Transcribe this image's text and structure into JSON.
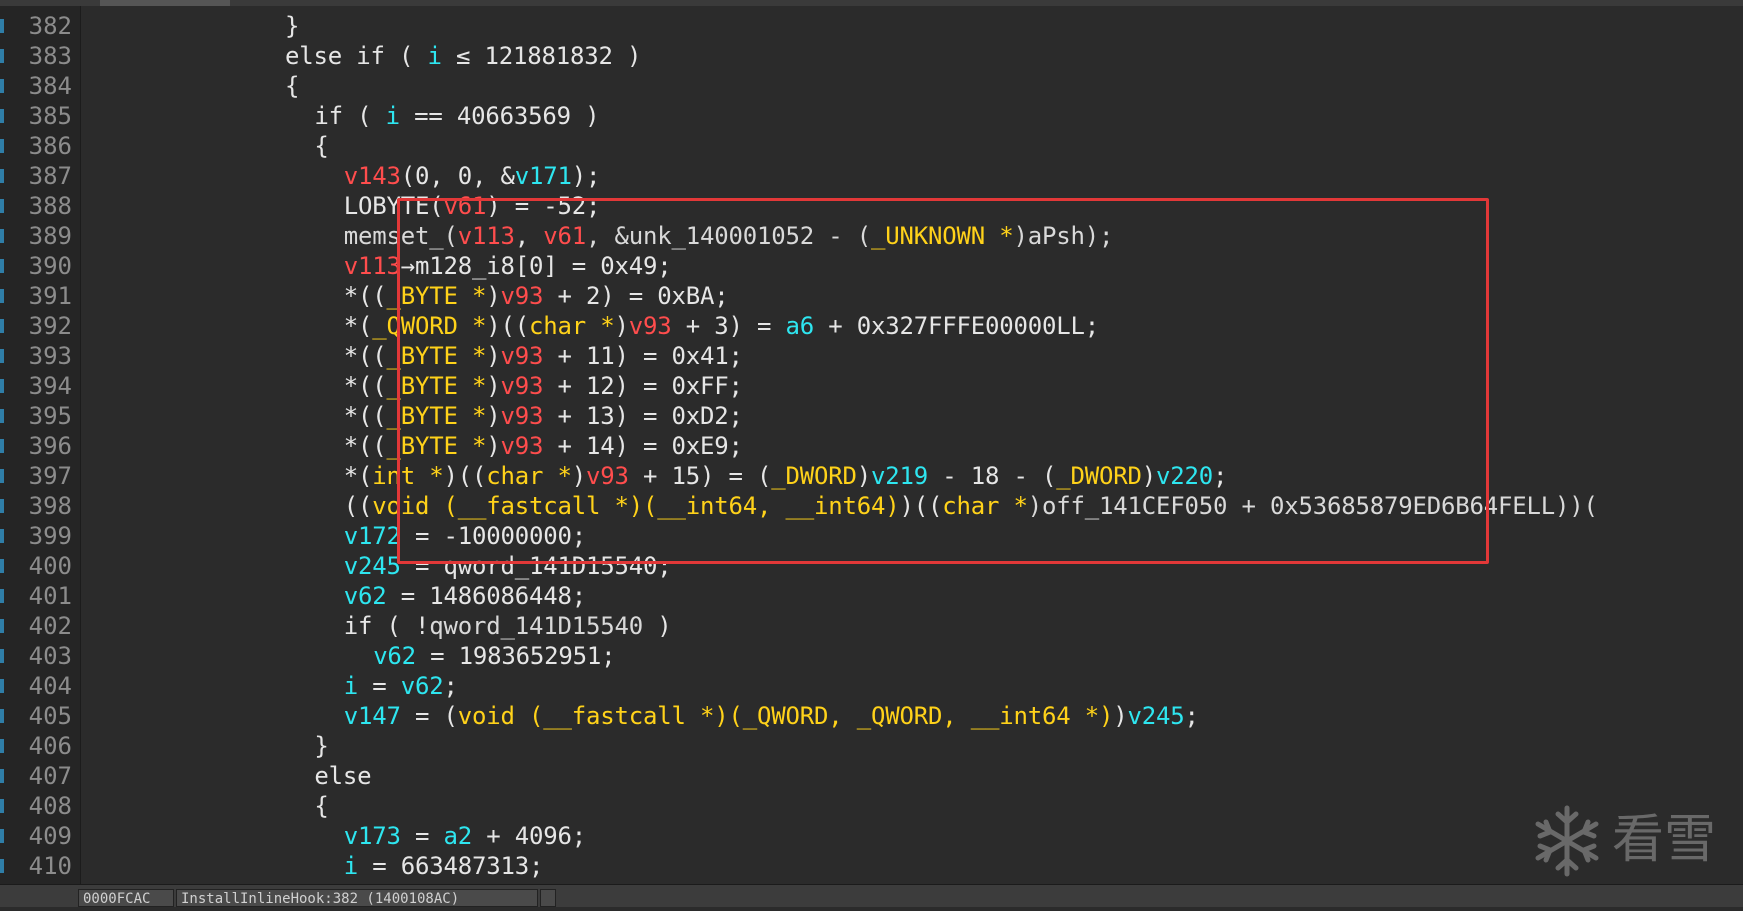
{
  "editor": {
    "lines": [
      {
        "num": "382",
        "indent": 12,
        "tokens": [
          {
            "t": "}",
            "c": "d"
          }
        ]
      },
      {
        "num": "383",
        "indent": 12,
        "tokens": [
          {
            "t": "else if ( ",
            "c": "d"
          },
          {
            "t": "i",
            "c": "g"
          },
          {
            "t": " ≤ 121881832 )",
            "c": "d"
          }
        ]
      },
      {
        "num": "384",
        "indent": 12,
        "tokens": [
          {
            "t": "{",
            "c": "d"
          }
        ]
      },
      {
        "num": "385",
        "indent": 14,
        "tokens": [
          {
            "t": "if ( ",
            "c": "d"
          },
          {
            "t": "i",
            "c": "g"
          },
          {
            "t": " == 40663569 )",
            "c": "d"
          }
        ]
      },
      {
        "num": "386",
        "indent": 14,
        "tokens": [
          {
            "t": "{",
            "c": "d"
          }
        ]
      },
      {
        "num": "387",
        "indent": 16,
        "tokens": [
          {
            "t": "v143",
            "c": "l"
          },
          {
            "t": "(0, 0, &",
            "c": "d"
          },
          {
            "t": "v171",
            "c": "g"
          },
          {
            "t": ");",
            "c": "d"
          }
        ]
      },
      {
        "num": "388",
        "indent": 16,
        "tokens": [
          {
            "t": "LOBYTE(",
            "c": "d"
          },
          {
            "t": "v61",
            "c": "l"
          },
          {
            "t": ") = -52;",
            "c": "d"
          }
        ]
      },
      {
        "num": "389",
        "indent": 16,
        "tokens": [
          {
            "t": "memset_(",
            "c": "o"
          },
          {
            "t": "v113",
            "c": "l"
          },
          {
            "t": ", ",
            "c": "d"
          },
          {
            "t": "v61",
            "c": "l"
          },
          {
            "t": ", &unk_140001052 - (",
            "c": "o"
          },
          {
            "t": "_UNKNOWN *",
            "c": "y"
          },
          {
            "t": ")aPsh);",
            "c": "o"
          }
        ]
      },
      {
        "num": "390",
        "indent": 16,
        "tokens": [
          {
            "t": "v113",
            "c": "l"
          },
          {
            "t": "→m128_i8[0] = 0x49;",
            "c": "d"
          }
        ]
      },
      {
        "num": "391",
        "indent": 16,
        "tokens": [
          {
            "t": "*((",
            "c": "d"
          },
          {
            "t": "_BYTE *",
            "c": "y"
          },
          {
            "t": ")",
            "c": "d"
          },
          {
            "t": "v93",
            "c": "l"
          },
          {
            "t": " + 2) = 0xBA;",
            "c": "d"
          }
        ]
      },
      {
        "num": "392",
        "indent": 16,
        "tokens": [
          {
            "t": "*(",
            "c": "d"
          },
          {
            "t": "_QWORD *",
            "c": "y"
          },
          {
            "t": ")((",
            "c": "d"
          },
          {
            "t": "char *",
            "c": "y"
          },
          {
            "t": ")",
            "c": "d"
          },
          {
            "t": "v93",
            "c": "l"
          },
          {
            "t": " + 3) = ",
            "c": "d"
          },
          {
            "t": "a6",
            "c": "g"
          },
          {
            "t": " + 0x327FFFE00000LL;",
            "c": "d"
          }
        ]
      },
      {
        "num": "393",
        "indent": 16,
        "tokens": [
          {
            "t": "*((",
            "c": "d"
          },
          {
            "t": "_BYTE *",
            "c": "y"
          },
          {
            "t": ")",
            "c": "d"
          },
          {
            "t": "v93",
            "c": "l"
          },
          {
            "t": " + 11) = 0x41;",
            "c": "d"
          }
        ]
      },
      {
        "num": "394",
        "indent": 16,
        "tokens": [
          {
            "t": "*((",
            "c": "d"
          },
          {
            "t": "_BYTE *",
            "c": "y"
          },
          {
            "t": ")",
            "c": "d"
          },
          {
            "t": "v93",
            "c": "l"
          },
          {
            "t": " + 12) = 0xFF;",
            "c": "d"
          }
        ]
      },
      {
        "num": "395",
        "indent": 16,
        "tokens": [
          {
            "t": "*((",
            "c": "d"
          },
          {
            "t": "_BYTE *",
            "c": "y"
          },
          {
            "t": ")",
            "c": "d"
          },
          {
            "t": "v93",
            "c": "l"
          },
          {
            "t": " + 13) = 0xD2;",
            "c": "d"
          }
        ]
      },
      {
        "num": "396",
        "indent": 16,
        "tokens": [
          {
            "t": "*((",
            "c": "d"
          },
          {
            "t": "_BYTE *",
            "c": "y"
          },
          {
            "t": ")",
            "c": "d"
          },
          {
            "t": "v93",
            "c": "l"
          },
          {
            "t": " + 14) = 0xE9;",
            "c": "d"
          }
        ]
      },
      {
        "num": "397",
        "indent": 16,
        "tokens": [
          {
            "t": "*(",
            "c": "d"
          },
          {
            "t": "int *",
            "c": "y"
          },
          {
            "t": ")((",
            "c": "d"
          },
          {
            "t": "char *",
            "c": "y"
          },
          {
            "t": ")",
            "c": "d"
          },
          {
            "t": "v93",
            "c": "l"
          },
          {
            "t": " + 15) = (",
            "c": "d"
          },
          {
            "t": "_DWORD",
            "c": "y"
          },
          {
            "t": ")",
            "c": "d"
          },
          {
            "t": "v219",
            "c": "g"
          },
          {
            "t": " - 18 - (",
            "c": "d"
          },
          {
            "t": "_DWORD",
            "c": "y"
          },
          {
            "t": ")",
            "c": "d"
          },
          {
            "t": "v220",
            "c": "g"
          },
          {
            "t": ";",
            "c": "d"
          }
        ]
      },
      {
        "num": "398",
        "indent": 16,
        "tokens": [
          {
            "t": "((",
            "c": "d"
          },
          {
            "t": "void (__fastcall *)(__int64, __int64)",
            "c": "y"
          },
          {
            "t": ")((",
            "c": "d"
          },
          {
            "t": "char *",
            "c": "y"
          },
          {
            "t": ")off_141CEF050 + 0x53685879ED6B64FELL))(",
            "c": "o"
          }
        ]
      },
      {
        "num": "399",
        "indent": 16,
        "tokens": [
          {
            "t": "v172",
            "c": "g"
          },
          {
            "t": " = -10000000;",
            "c": "d"
          }
        ]
      },
      {
        "num": "400",
        "indent": 16,
        "tokens": [
          {
            "t": "v245",
            "c": "g"
          },
          {
            "t": " = qword_141D15540;",
            "c": "d"
          }
        ]
      },
      {
        "num": "401",
        "indent": 16,
        "tokens": [
          {
            "t": "v62",
            "c": "g"
          },
          {
            "t": " = 1486086448;",
            "c": "d"
          }
        ]
      },
      {
        "num": "402",
        "indent": 16,
        "tokens": [
          {
            "t": "if ( !",
            "c": "d"
          },
          {
            "t": "qword_141D15540",
            "c": "o"
          },
          {
            "t": " )",
            "c": "d"
          }
        ]
      },
      {
        "num": "403",
        "indent": 18,
        "tokens": [
          {
            "t": "v62",
            "c": "g"
          },
          {
            "t": " = 1983652951;",
            "c": "d"
          }
        ]
      },
      {
        "num": "404",
        "indent": 16,
        "tokens": [
          {
            "t": "i",
            "c": "g"
          },
          {
            "t": " = ",
            "c": "d"
          },
          {
            "t": "v62",
            "c": "g"
          },
          {
            "t": ";",
            "c": "d"
          }
        ]
      },
      {
        "num": "405",
        "indent": 16,
        "tokens": [
          {
            "t": "v147",
            "c": "g"
          },
          {
            "t": " = (",
            "c": "d"
          },
          {
            "t": "void (__fastcall *)(_QWORD, _QWORD, __int64 *)",
            "c": "y"
          },
          {
            "t": ")",
            "c": "d"
          },
          {
            "t": "v245",
            "c": "g"
          },
          {
            "t": ";",
            "c": "d"
          }
        ]
      },
      {
        "num": "406",
        "indent": 14,
        "tokens": [
          {
            "t": "}",
            "c": "d"
          }
        ]
      },
      {
        "num": "407",
        "indent": 14,
        "tokens": [
          {
            "t": "else",
            "c": "d"
          }
        ]
      },
      {
        "num": "408",
        "indent": 14,
        "tokens": [
          {
            "t": "{",
            "c": "d"
          }
        ]
      },
      {
        "num": "409",
        "indent": 16,
        "tokens": [
          {
            "t": "v173",
            "c": "g"
          },
          {
            "t": " = ",
            "c": "d"
          },
          {
            "t": "a2",
            "c": "g"
          },
          {
            "t": " + 4096;",
            "c": "d"
          }
        ]
      },
      {
        "num": "410",
        "indent": 16,
        "tokens": [
          {
            "t": "i",
            "c": "g"
          },
          {
            "t": " = 663487313;",
            "c": "d"
          }
        ]
      },
      {
        "num": "",
        "indent": 14,
        "tokens": [
          {
            "t": "}",
            "c": "d"
          }
        ]
      }
    ]
  },
  "statusbar": {
    "address": "0000FCAC",
    "location": "InstallInlineHook:382 (1400108AC)"
  },
  "watermark": {
    "icon": "snowflake-icon",
    "text": "看雪"
  },
  "colors": {
    "background": "#2b2b2b",
    "local_var": "#ff4d4d",
    "global_var": "#2ee6f0",
    "type": "#ffd21a",
    "highlight_box": "#e23838"
  }
}
